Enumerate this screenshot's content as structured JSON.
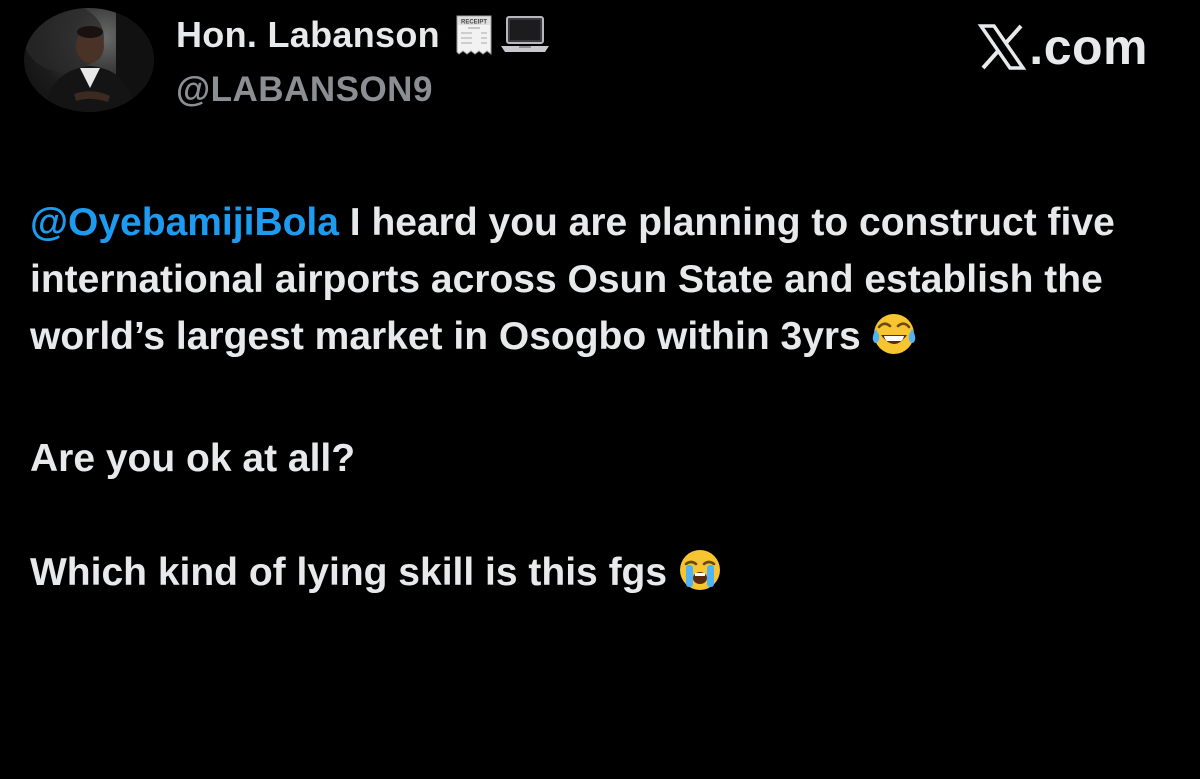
{
  "header": {
    "display_name": "Hon. Labanson",
    "handle": "@LABANSON9",
    "badges": [
      {
        "icon": "receipt-emoji-icon",
        "text": "RECEIPT"
      },
      {
        "icon": "laptop-emoji-icon"
      }
    ],
    "brand": {
      "logo_icon": "x-logo-icon",
      "text": ".com"
    }
  },
  "tweet": {
    "mention": "@OyebamijiBola",
    "paragraph1_text": "I heard you are planning to construct five international airports across Osun State and establish the world’s largest market in Osogbo within 3yrs",
    "paragraph1_emoji": "face-with-tears-of-joy-icon",
    "paragraph2_text": "Are you ok at all?",
    "paragraph3_text": "Which kind of lying skill is this fgs",
    "paragraph3_emoji": "loudly-crying-face-icon"
  },
  "colors": {
    "background": "#000000",
    "text": "#e7e9ea",
    "handle": "#8b8f94",
    "mention": "#1d9bf0"
  }
}
